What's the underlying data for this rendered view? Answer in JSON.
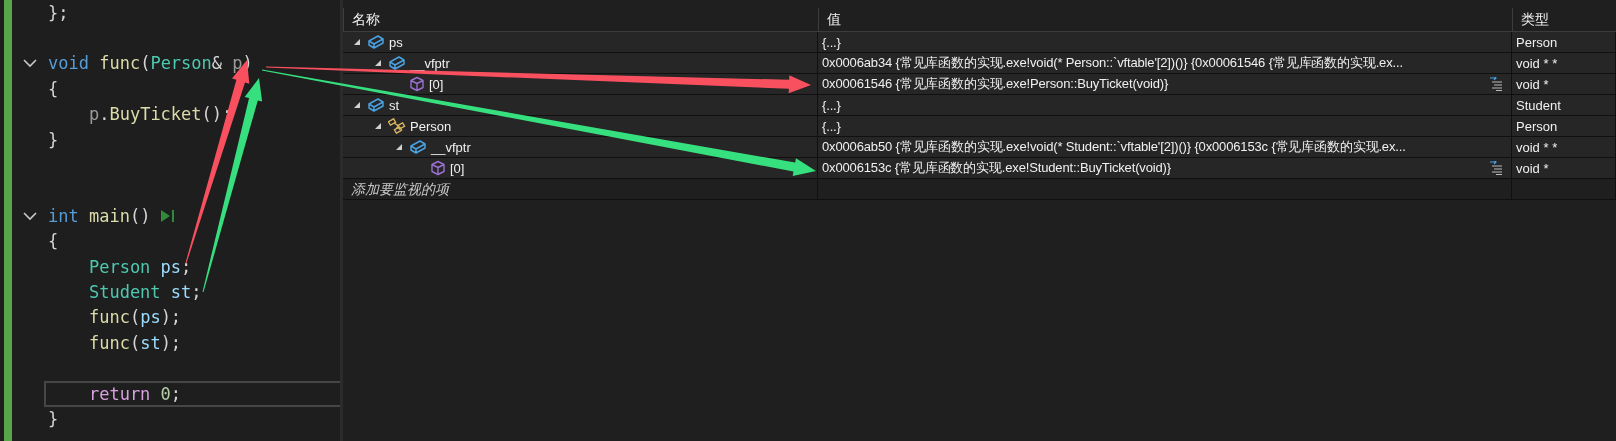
{
  "editor": {
    "lines": [
      {
        "kind": "code",
        "tokens": [
          {
            "t": "};",
            "kind": "punct"
          }
        ]
      },
      {
        "kind": "blank"
      },
      {
        "kind": "code",
        "fold": true,
        "tokens": [
          {
            "t": "void",
            "kind": "keyword"
          },
          {
            "t": " func",
            "kind": "function"
          },
          {
            "t": "(",
            "kind": "punct"
          },
          {
            "t": "Person",
            "kind": "type"
          },
          {
            "t": "& ",
            "kind": "punct"
          },
          {
            "t": "p",
            "kind": "param"
          },
          {
            "t": ")",
            "kind": "punct"
          }
        ]
      },
      {
        "kind": "code",
        "tokens": [
          {
            "t": "{",
            "kind": "punct"
          }
        ]
      },
      {
        "kind": "code",
        "tokens": [
          {
            "t": "    p",
            "kind": "param"
          },
          {
            "t": ".",
            "kind": "punct"
          },
          {
            "t": "BuyTicket",
            "kind": "function"
          },
          {
            "t": "();",
            "kind": "punct"
          }
        ]
      },
      {
        "kind": "code",
        "tokens": [
          {
            "t": "}",
            "kind": "punct"
          }
        ]
      },
      {
        "kind": "blank"
      },
      {
        "kind": "blank"
      },
      {
        "kind": "code",
        "fold": true,
        "run": true,
        "tokens": [
          {
            "t": "int",
            "kind": "keyword"
          },
          {
            "t": " main",
            "kind": "function"
          },
          {
            "t": "()",
            "kind": "punct"
          }
        ]
      },
      {
        "kind": "code",
        "tokens": [
          {
            "t": "{",
            "kind": "punct"
          }
        ]
      },
      {
        "kind": "code",
        "tokens": [
          {
            "t": "    Person",
            "kind": "type"
          },
          {
            "t": " ps",
            "kind": "variable"
          },
          {
            "t": ";",
            "kind": "punct"
          }
        ]
      },
      {
        "kind": "code",
        "tokens": [
          {
            "t": "    Student",
            "kind": "type"
          },
          {
            "t": " st",
            "kind": "variable"
          },
          {
            "t": ";",
            "kind": "punct"
          }
        ]
      },
      {
        "kind": "code",
        "tokens": [
          {
            "t": "    func",
            "kind": "function"
          },
          {
            "t": "(",
            "kind": "punct"
          },
          {
            "t": "ps",
            "kind": "variable"
          },
          {
            "t": ");",
            "kind": "punct"
          }
        ]
      },
      {
        "kind": "code",
        "tokens": [
          {
            "t": "    func",
            "kind": "function"
          },
          {
            "t": "(",
            "kind": "punct"
          },
          {
            "t": "st",
            "kind": "variable"
          },
          {
            "t": ");",
            "kind": "punct"
          }
        ]
      },
      {
        "kind": "blank"
      },
      {
        "kind": "code",
        "current": true,
        "tokens": [
          {
            "t": "    return",
            "kind": "control"
          },
          {
            "t": " 0",
            "kind": "number"
          },
          {
            "t": ";",
            "kind": "punct"
          }
        ]
      },
      {
        "kind": "code",
        "tokens": [
          {
            "t": "}",
            "kind": "punct"
          }
        ]
      }
    ]
  },
  "watch": {
    "columns": [
      "名称",
      "值",
      "类型"
    ],
    "items": [
      {
        "name": "ps",
        "value": "{...}",
        "type": "Person",
        "kind": "object",
        "expanded": true,
        "children": [
          {
            "name": "__vfptr",
            "value": "0x0006ab34 {常见库函数的实现.exe!void(* Person::`vftable'[2])()} {0x00061546 {常见库函数的实现.ex...",
            "type": "void * *",
            "kind": "object",
            "expanded": true,
            "children": [
              {
                "name": "[0]",
                "value": "0x00061546 {常见库函数的实现.exe!Person::BuyTicket(void)}",
                "type": "void *",
                "kind": "pointer",
                "visualizer": true
              }
            ]
          }
        ]
      },
      {
        "name": "st",
        "value": "{...}",
        "type": "Student",
        "kind": "object",
        "expanded": true,
        "children": [
          {
            "name": "Person",
            "value": "{...}",
            "type": "Person",
            "kind": "base",
            "expanded": true,
            "children": [
              {
                "name": "__vfptr",
                "value": "0x0006ab50 {常见库函数的实现.exe!void(* Student::`vftable'[2])()} {0x0006153c {常见库函数的实现.ex...",
                "type": "void * *",
                "kind": "object",
                "expanded": true,
                "children": [
                  {
                    "name": "[0]",
                    "value": "0x0006153c {常见库函数的实现.exe!Student::BuyTicket(void)}",
                    "type": "void *",
                    "kind": "pointer",
                    "visualizer": true
                  }
                ]
              }
            ]
          }
        ]
      }
    ],
    "add_placeholder": "添加要监视的项"
  },
  "arrows": [
    {
      "color": "#f9505f"
    },
    {
      "color": "#f9505f"
    },
    {
      "color": "#37e07e"
    },
    {
      "color": "#37e07e"
    }
  ]
}
